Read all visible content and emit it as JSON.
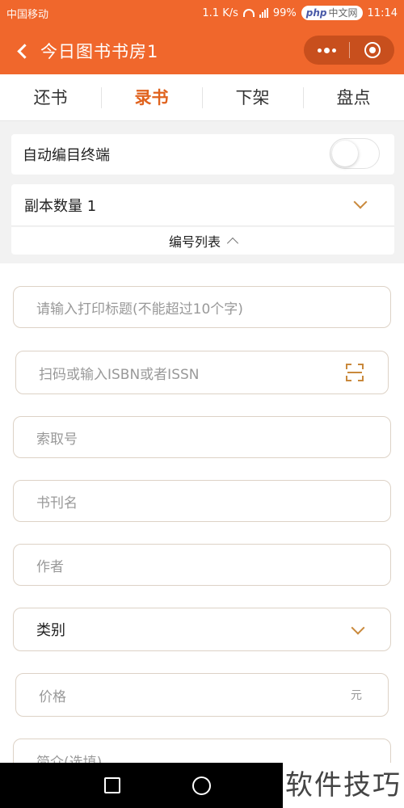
{
  "status_bar": {
    "carrier": "中国移动",
    "speed": "1.1 K/s",
    "battery": "99%",
    "badge_php": "php",
    "badge_cn": "中文网",
    "time": "11:14"
  },
  "nav": {
    "title": "今日图书书房1"
  },
  "tabs": [
    {
      "label": "还书",
      "active": false
    },
    {
      "label": "录书",
      "active": true
    },
    {
      "label": "下架",
      "active": false
    },
    {
      "label": "盘点",
      "active": false
    }
  ],
  "settings": {
    "auto_catalog_label": "自动编目终端",
    "auto_catalog_on": false,
    "copies_label": "副本数量 1",
    "number_list_label": "编号列表"
  },
  "form": {
    "print_title_placeholder": "请输入打印标题(不能超过10个字)",
    "isbn_placeholder": "扫码或输入ISBN或者ISSN",
    "call_number_placeholder": "索取号",
    "book_name_placeholder": "书刊名",
    "author_placeholder": "作者",
    "category_label": "类别",
    "price_placeholder": "价格",
    "price_unit": "元",
    "summary_placeholder": "简介(选填)"
  },
  "watermark": "软件技巧",
  "colors": {
    "brand": "#f0672c",
    "active_tab": "#e0631e",
    "accent_icon": "#c9893c"
  }
}
